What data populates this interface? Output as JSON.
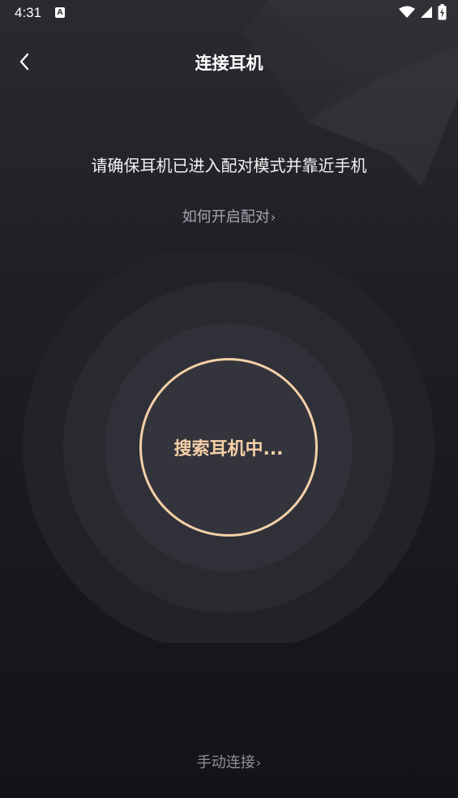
{
  "status_bar": {
    "time": "4:31",
    "notification_icon_letter": "A",
    "icons": [
      "wifi-icon",
      "signal-icon",
      "battery-charging-icon"
    ]
  },
  "header": {
    "title": "连接耳机",
    "back_icon": "chevron-left-icon"
  },
  "instruction": "请确保耳机已进入配对模式并靠近手机",
  "how_to_pair": {
    "label": "如何开启配对",
    "chevron": "›"
  },
  "search": {
    "label": "搜索耳机中..."
  },
  "manual_connect": {
    "label": "手动连接",
    "chevron": "›"
  },
  "colors": {
    "accent": "#f4d0a8",
    "background": "#1f1f25",
    "link": "#a7a7b2"
  }
}
